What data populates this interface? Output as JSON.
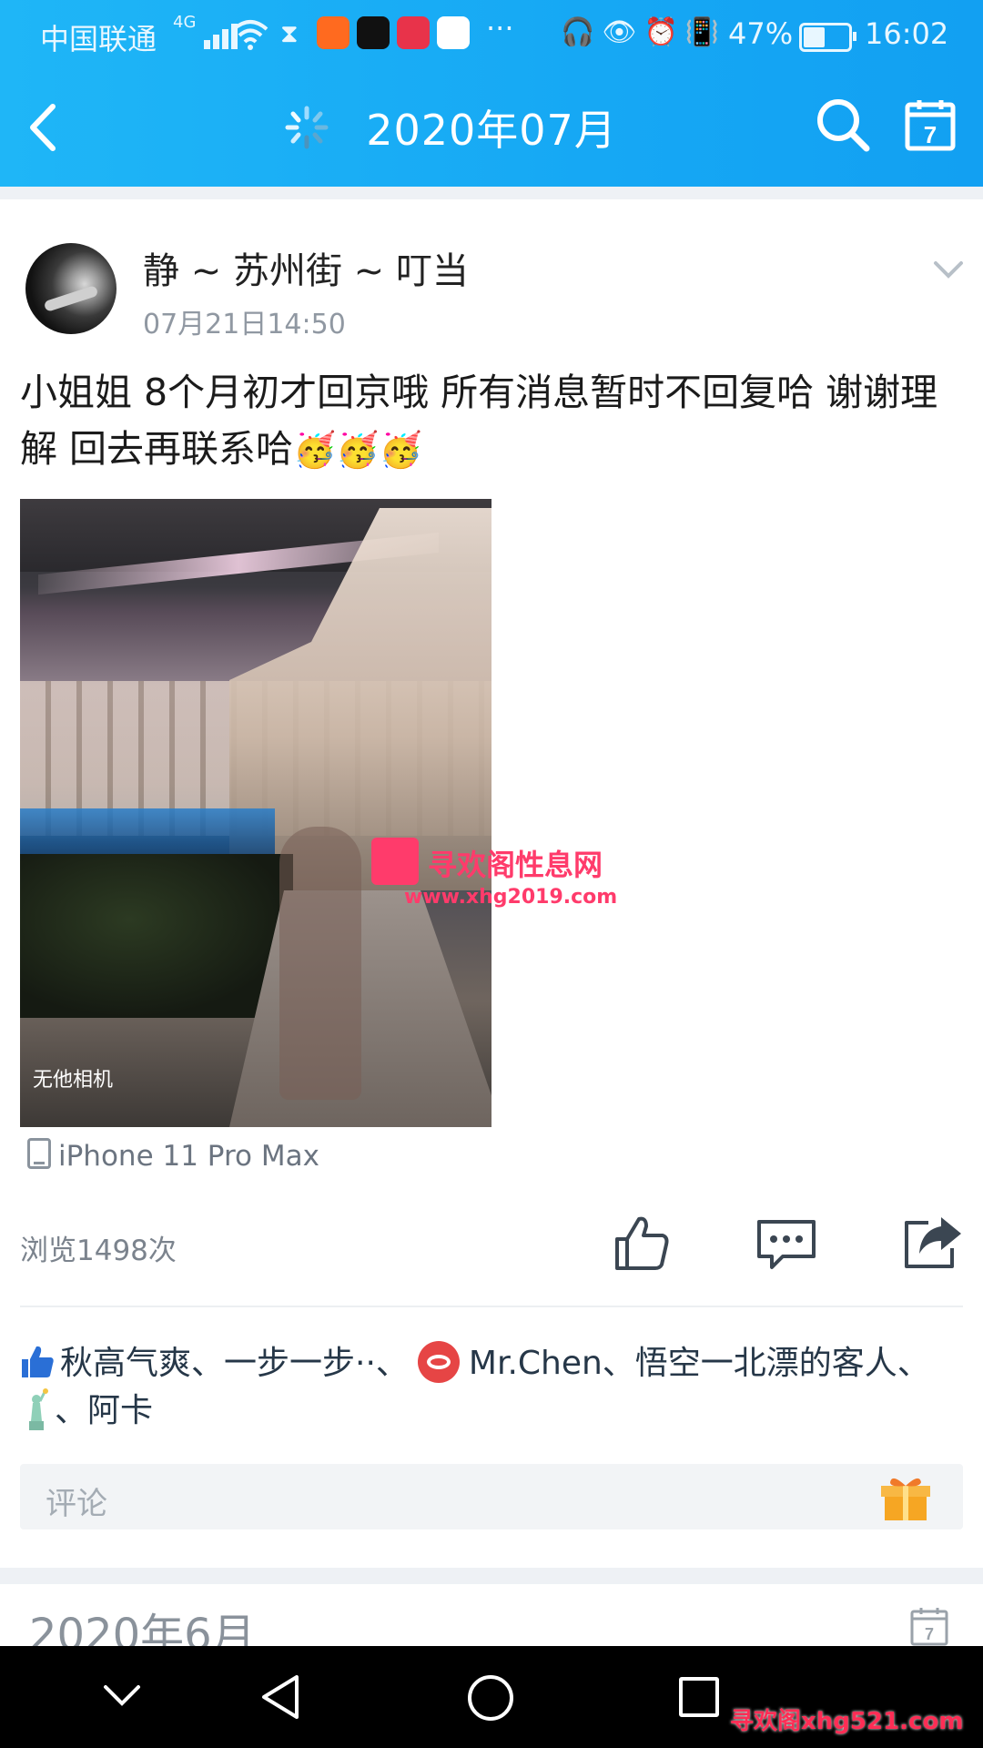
{
  "status_bar": {
    "carrier": "中国联通",
    "network": "4G",
    "battery": "47%",
    "battery_level": 0.47,
    "time": "16:02",
    "overflow": "···"
  },
  "header": {
    "title": "2020年07月",
    "color": "#16a8f4"
  },
  "post": {
    "author": "静 ~ 苏州街 ~ 叮当",
    "timestamp": "07月21日14:50",
    "text": "小姐姐 8个月初才回京哦 所有消息暂时不回复哈 谢谢理解 回去再联系哈",
    "emojis": "🥳🥳🥳",
    "photo_watermark": "无他相机",
    "device": "iPhone 11 Pro Max",
    "views": "浏览1498次"
  },
  "likes": {
    "names_line1": "秋高气爽、一步一步··、",
    "name_mrchen": "Mr.Chen、悟空一北漂的客人、",
    "names_line2": "、阿卡"
  },
  "comment": {
    "placeholder": "评论"
  },
  "next_section": {
    "month": "2020年6月"
  },
  "watermarks": {
    "center_line1": "寻欢阁性息网",
    "center_line2": "www.xhg2019.com",
    "bottom": "寻欢阁xhg521.com"
  }
}
